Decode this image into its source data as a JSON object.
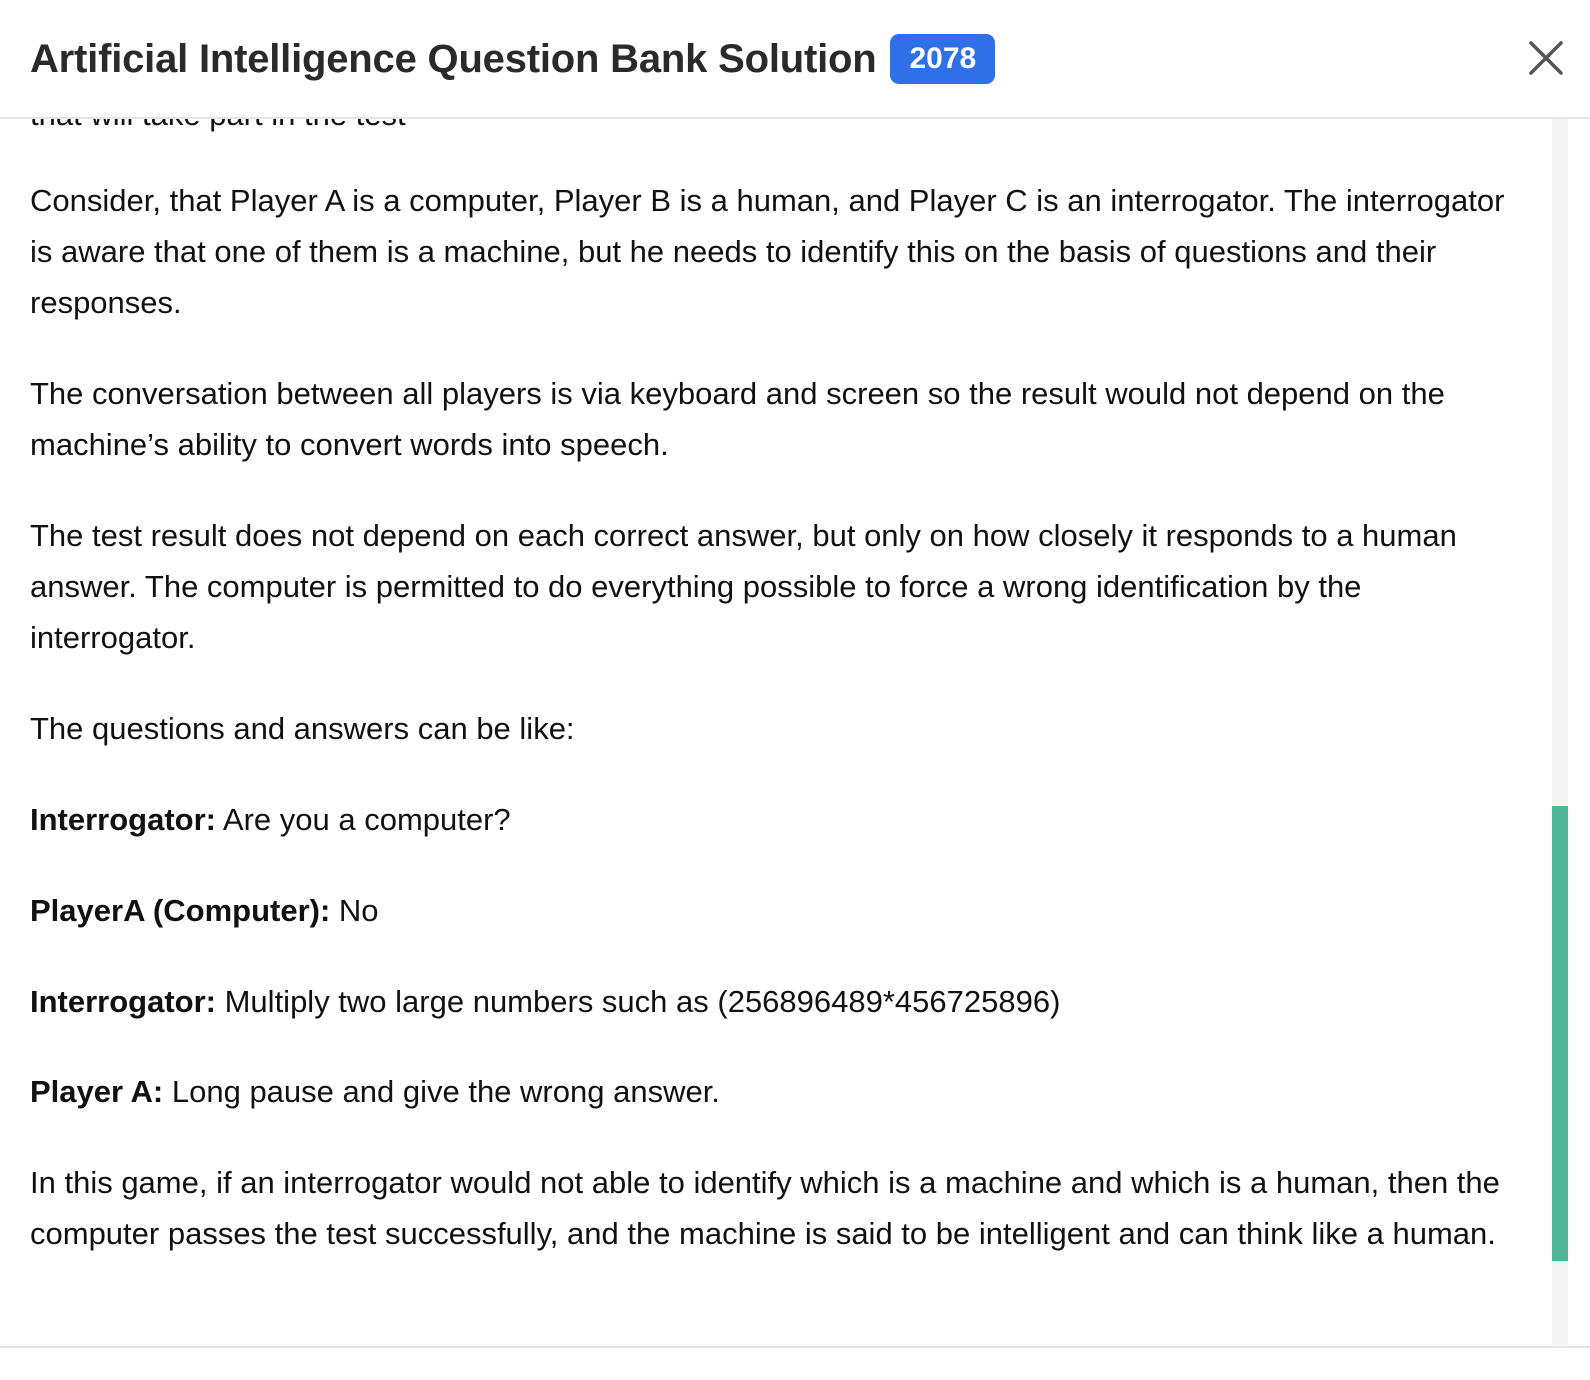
{
  "header": {
    "title": "Artificial Intelligence Question Bank Solution",
    "badge": "2078",
    "close_icon": "close-icon"
  },
  "content": {
    "cut_off_line": "that will take part in the test",
    "p1": "Consider, that Player A is a computer, Player B is a human, and Player C is an interrogator. The interrogator is aware that one of them is a machine, but he needs to identify this on the basis of questions and their responses.",
    "p2": "The conversation between all players is via keyboard and screen so the result would not depend on the machine’s ability to convert words into speech.",
    "p3": "The test result does not depend on each correct answer, but only on how closely it responds to a human answer. The computer is permitted to do everything possible to force a wrong identification by the interrogator.",
    "p4": "The questions and answers can be like:",
    "dialogue": [
      {
        "speaker": "Interrogator:",
        "text": " Are you a computer?"
      },
      {
        "speaker": "PlayerA (Computer):",
        "text": " No"
      },
      {
        "speaker": "Interrogator:",
        "text": " Multiply two large numbers such as (256896489*456725896)"
      },
      {
        "speaker": "Player A:",
        "text": " Long pause and give the wrong answer."
      }
    ],
    "p5": "In this game, if an interrogator would not able to identify which is a machine and which is a human, then the computer passes the test successfully, and the machine is said to be intelligent and can think like a human."
  },
  "colors": {
    "badge": "#2f6fe8",
    "scroll_thumb": "#4fb596"
  }
}
